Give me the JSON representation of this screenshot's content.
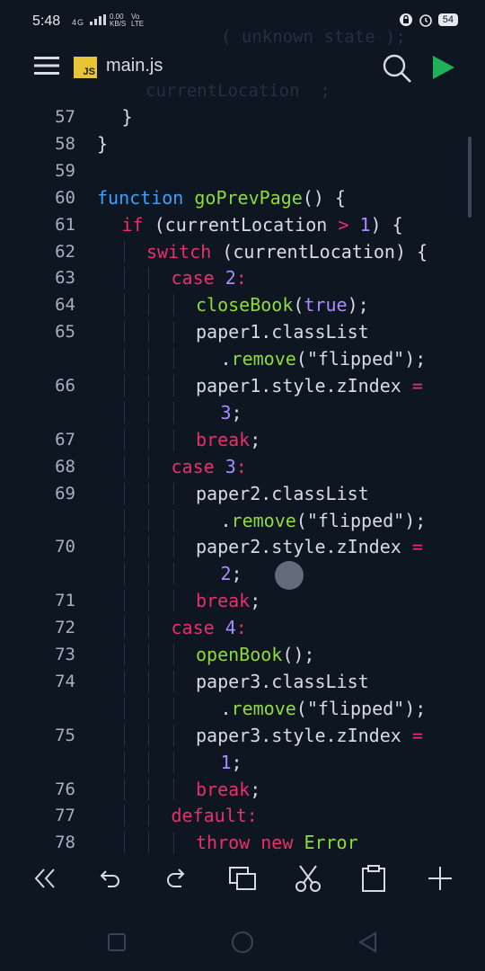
{
  "status_bar": {
    "time": "5:48",
    "net_label": "4G",
    "speed_top": "0.00",
    "speed_bottom": "KB/S",
    "carrier_top": "Vo",
    "carrier_bottom": "LTE",
    "battery": "54"
  },
  "header": {
    "file_badge": "JS",
    "filename": "main.js",
    "ghost_line_1": "( unknown state );",
    "ghost_line_2": "currentLocation  ;"
  },
  "code": {
    "lines": [
      {
        "n": "57",
        "indent": 1,
        "tokens": [
          {
            "t": "}",
            "c": ""
          }
        ]
      },
      {
        "n": "58",
        "indent": 0,
        "tokens": [
          {
            "t": "}",
            "c": ""
          }
        ]
      },
      {
        "n": "59",
        "indent": 0,
        "tokens": []
      },
      {
        "n": "60",
        "indent": 0,
        "tokens": [
          {
            "t": "function ",
            "c": "kw-blue"
          },
          {
            "t": "goPrevPage",
            "c": "fn"
          },
          {
            "t": "() {",
            "c": ""
          }
        ]
      },
      {
        "n": "61",
        "indent": 1,
        "tokens": [
          {
            "t": "if",
            "c": "kw"
          },
          {
            "t": " (currentLocation ",
            "c": ""
          },
          {
            "t": ">",
            "c": "kw"
          },
          {
            "t": " ",
            "c": ""
          },
          {
            "t": "1",
            "c": "num"
          },
          {
            "t": ") {",
            "c": ""
          }
        ]
      },
      {
        "n": "62",
        "indent": 2,
        "tokens": [
          {
            "t": "switch",
            "c": "kw"
          },
          {
            "t": " (currentLocation) {",
            "c": ""
          }
        ]
      },
      {
        "n": "63",
        "indent": 3,
        "tokens": [
          {
            "t": "case",
            "c": "kw"
          },
          {
            "t": " ",
            "c": ""
          },
          {
            "t": "2",
            "c": "num"
          },
          {
            "t": ":",
            "c": "kw"
          }
        ]
      },
      {
        "n": "64",
        "indent": 4,
        "tokens": [
          {
            "t": "closeBook",
            "c": "fn"
          },
          {
            "t": "(",
            "c": ""
          },
          {
            "t": "true",
            "c": "bool"
          },
          {
            "t": ");",
            "c": ""
          }
        ]
      },
      {
        "n": "65",
        "indent": 4,
        "tokens": [
          {
            "t": "paper1.classList",
            "c": ""
          }
        ]
      },
      {
        "n": "",
        "indent": 5,
        "tokens": [
          {
            "t": ".",
            "c": ""
          },
          {
            "t": "remove",
            "c": "fn"
          },
          {
            "t": "(\"flipped\");",
            "c": ""
          }
        ]
      },
      {
        "n": "66",
        "indent": 4,
        "tokens": [
          {
            "t": "paper1.style.zIndex ",
            "c": ""
          },
          {
            "t": "=",
            "c": "kw"
          }
        ]
      },
      {
        "n": "",
        "indent": 5,
        "tokens": [
          {
            "t": "3",
            "c": "num"
          },
          {
            "t": ";",
            "c": ""
          }
        ]
      },
      {
        "n": "67",
        "indent": 4,
        "tokens": [
          {
            "t": "break",
            "c": "kw"
          },
          {
            "t": ";",
            "c": ""
          }
        ]
      },
      {
        "n": "68",
        "indent": 3,
        "tokens": [
          {
            "t": "case",
            "c": "kw"
          },
          {
            "t": " ",
            "c": ""
          },
          {
            "t": "3",
            "c": "num"
          },
          {
            "t": ":",
            "c": "kw"
          }
        ]
      },
      {
        "n": "69",
        "indent": 4,
        "tokens": [
          {
            "t": "paper2.classList",
            "c": ""
          }
        ]
      },
      {
        "n": "",
        "indent": 5,
        "tokens": [
          {
            "t": ".",
            "c": ""
          },
          {
            "t": "remove",
            "c": "fn"
          },
          {
            "t": "(\"flipped\");",
            "c": ""
          }
        ]
      },
      {
        "n": "70",
        "indent": 4,
        "tokens": [
          {
            "t": "paper2.style.zIndex ",
            "c": ""
          },
          {
            "t": "=",
            "c": "kw"
          }
        ]
      },
      {
        "n": "",
        "indent": 5,
        "tokens": [
          {
            "t": "2",
            "c": "num"
          },
          {
            "t": ";",
            "c": ""
          }
        ]
      },
      {
        "n": "71",
        "indent": 4,
        "tokens": [
          {
            "t": "break",
            "c": "kw"
          },
          {
            "t": ";",
            "c": ""
          }
        ]
      },
      {
        "n": "72",
        "indent": 3,
        "tokens": [
          {
            "t": "case",
            "c": "kw"
          },
          {
            "t": " ",
            "c": ""
          },
          {
            "t": "4",
            "c": "num"
          },
          {
            "t": ":",
            "c": "kw"
          }
        ]
      },
      {
        "n": "73",
        "indent": 4,
        "tokens": [
          {
            "t": "openBook",
            "c": "fn"
          },
          {
            "t": "();",
            "c": ""
          }
        ]
      },
      {
        "n": "74",
        "indent": 4,
        "tokens": [
          {
            "t": "paper3.classList",
            "c": ""
          }
        ]
      },
      {
        "n": "",
        "indent": 5,
        "tokens": [
          {
            "t": ".",
            "c": ""
          },
          {
            "t": "remove",
            "c": "fn"
          },
          {
            "t": "(\"flipped\");",
            "c": ""
          }
        ]
      },
      {
        "n": "75",
        "indent": 4,
        "tokens": [
          {
            "t": "paper3.style.zIndex ",
            "c": ""
          },
          {
            "t": "=",
            "c": "kw"
          }
        ]
      },
      {
        "n": "",
        "indent": 5,
        "tokens": [
          {
            "t": "1",
            "c": "num"
          },
          {
            "t": ";",
            "c": ""
          }
        ]
      },
      {
        "n": "76",
        "indent": 4,
        "tokens": [
          {
            "t": "break",
            "c": "kw"
          },
          {
            "t": ";",
            "c": ""
          }
        ]
      },
      {
        "n": "77",
        "indent": 3,
        "tokens": [
          {
            "t": "default",
            "c": "kw"
          },
          {
            "t": ":",
            "c": "kw"
          }
        ]
      },
      {
        "n": "78",
        "indent": 4,
        "tokens": [
          {
            "t": "throw",
            "c": "kw"
          },
          {
            "t": " ",
            "c": ""
          },
          {
            "t": "new",
            "c": "kw"
          },
          {
            "t": " ",
            "c": ""
          },
          {
            "t": "Error",
            "c": "fn"
          }
        ]
      }
    ]
  },
  "toolbar": {
    "icons": [
      "double-chevron-left-icon",
      "undo-icon",
      "redo-icon",
      "copy-icon",
      "cut-icon",
      "paste-icon",
      "add-icon"
    ]
  },
  "nav_bar": {
    "icons": [
      "recents-square-icon",
      "home-circle-icon",
      "back-triangle-icon"
    ]
  },
  "colors": {
    "background": "#0e1621",
    "keyword": "#ec2f6a",
    "function": "#8edb3a",
    "number": "#a98bff",
    "keyword_blue": "#3aa0ff",
    "run_green": "#1fb15a",
    "js_badge": "#e8c436"
  }
}
